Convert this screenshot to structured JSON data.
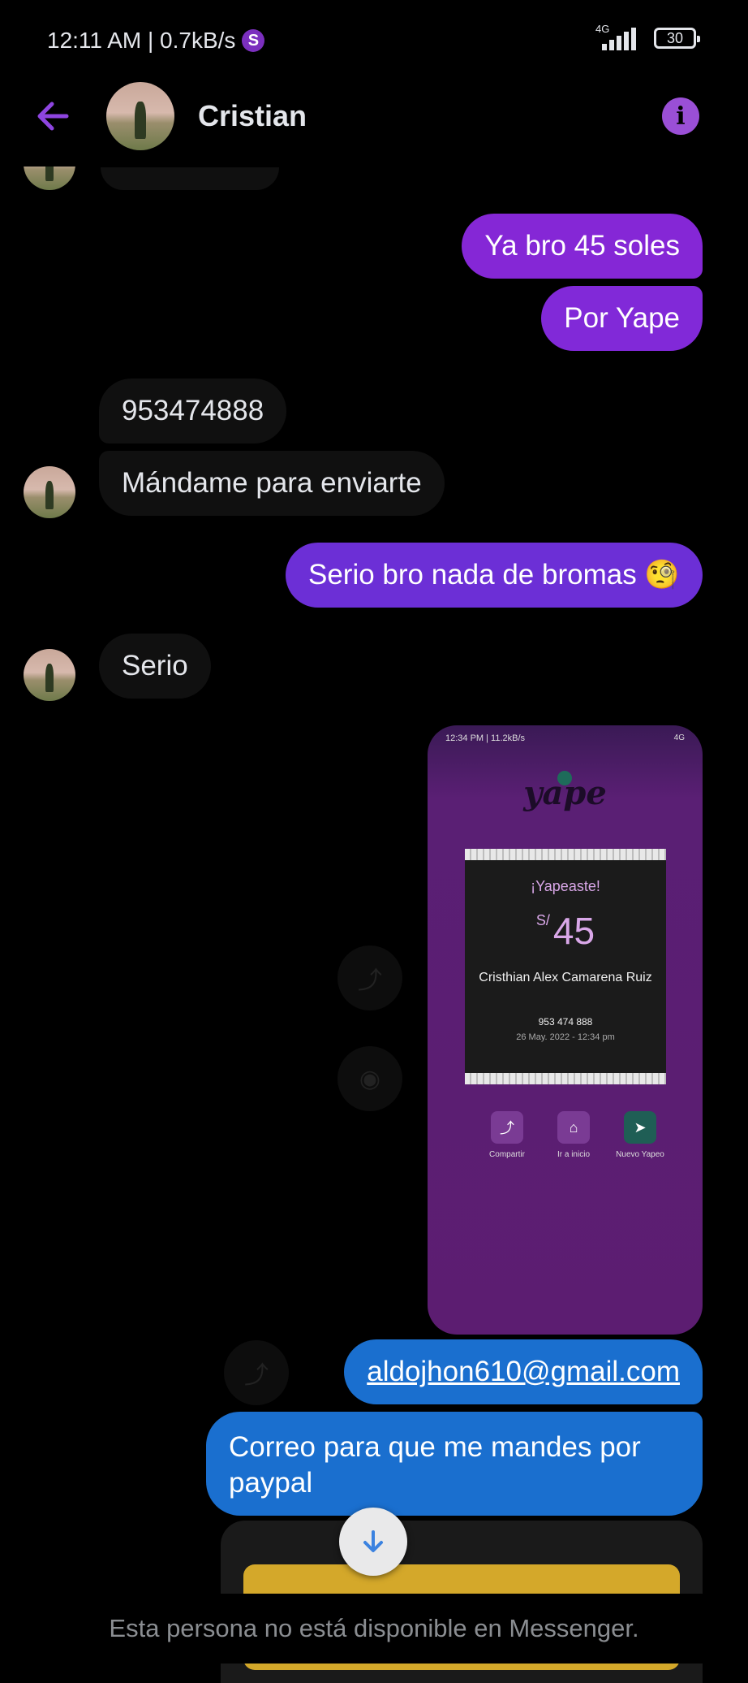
{
  "status_bar": {
    "left_text": "12:11 AM | 0.7kB/s",
    "s_icon": "S",
    "network": "4G",
    "battery": "30"
  },
  "header": {
    "contact_name": "Cristian",
    "info_icon": "i"
  },
  "messages": {
    "m1": "Ya bro 45 soles",
    "m2": "Por Yape",
    "m3": "953474888",
    "m4": "Mándame para enviarte",
    "m5": "Serio bro nada de bromas 🧐",
    "m6": "Serio",
    "m7": "aldojhon610@gmail.com",
    "m8_line1": "Correo para que me mandes por",
    "m8_line2": "paypal"
  },
  "colors": {
    "purple_a": "#8a2be2",
    "purple_b": "#6a2fd4",
    "blue": "#1a6fcf"
  },
  "yape_screenshot": {
    "status_left": "12:34 PM | 11.2kB/s",
    "status_right": "4G",
    "logo": "yape",
    "title": "¡Yapeaste!",
    "currency": "S/",
    "amount": "45",
    "recipient": "Cristhian Alex Camarena Ruiz",
    "phone": "953 474 888",
    "date": "26 May. 2022 - 12:34 pm",
    "actions": [
      "Compartir",
      "Ir a inicio",
      "Nuevo Yapeo"
    ]
  },
  "footer_text": "Esta persona no está disponible en Messenger."
}
